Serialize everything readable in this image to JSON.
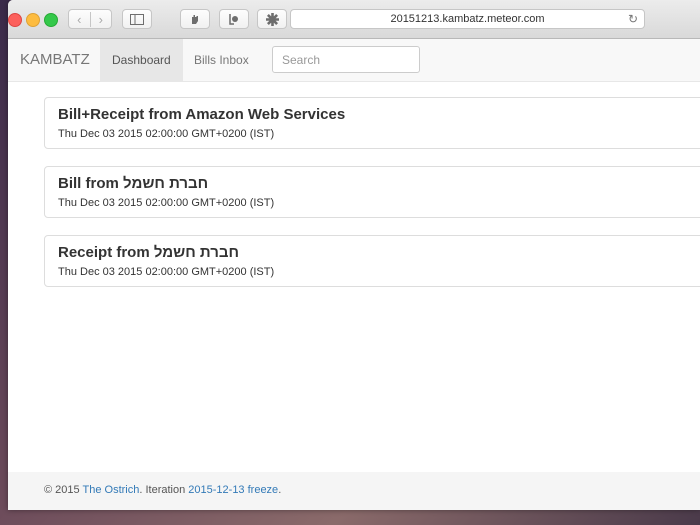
{
  "browser": {
    "url": "20151213.kambatz.meteor.com",
    "back_glyph": "‹",
    "forward_glyph": "›",
    "reload_glyph": "↻"
  },
  "navbar": {
    "brand": "KAMBATZ",
    "items": [
      {
        "label": "Dashboard",
        "active": true
      },
      {
        "label": "Bills Inbox",
        "active": false
      }
    ],
    "search_placeholder": "Search"
  },
  "cards": [
    {
      "title": "Bill+Receipt from Amazon Web Services",
      "date": "Thu Dec 03 2015 02:00:00 GMT+0200 (IST)"
    },
    {
      "title": "Bill from חברת חשמל",
      "date": "Thu Dec 03 2015 02:00:00 GMT+0200 (IST)"
    },
    {
      "title": "Receipt from חברת חשמל",
      "date": "Thu Dec 03 2015 02:00:00 GMT+0200 (IST)"
    }
  ],
  "footer": {
    "prefix": "© 2015 ",
    "author": "The Ostrich",
    "middle": ". Iteration ",
    "iteration": "2015-12-13 freeze",
    "suffix": "."
  },
  "colors": {
    "link": "#337ab7",
    "active_nav_bg": "#e7e7e7"
  }
}
